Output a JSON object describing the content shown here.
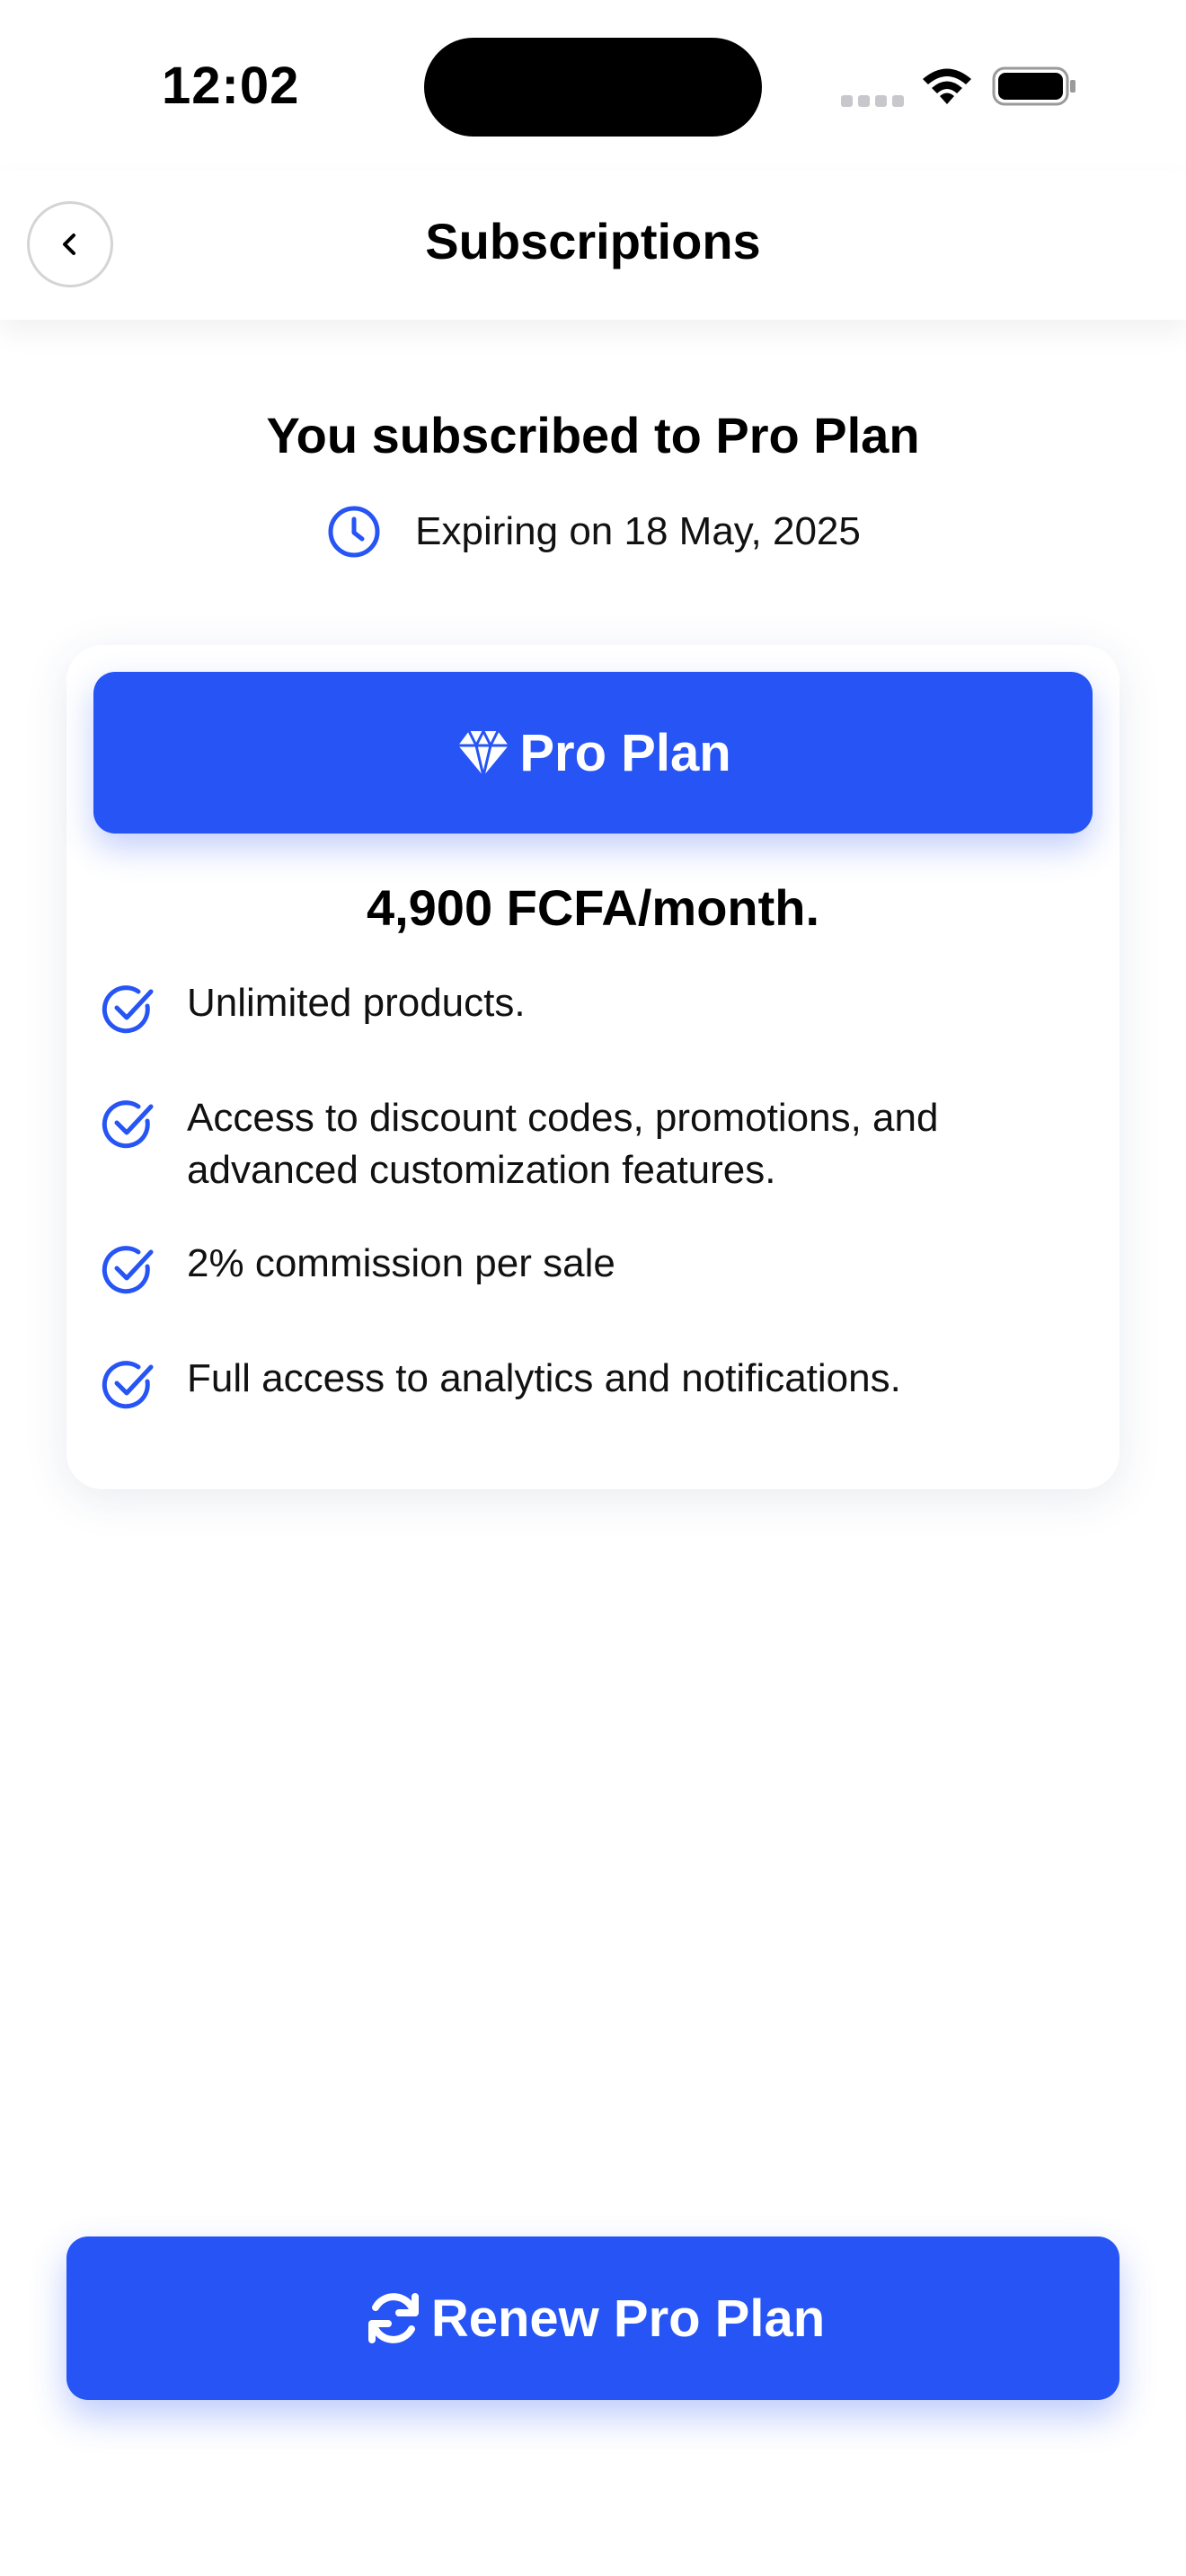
{
  "status_bar": {
    "time": "12:02",
    "icons": [
      "cellular-signal-icon",
      "wifi-icon",
      "battery-icon"
    ]
  },
  "header": {
    "title": "Subscriptions",
    "back_icon": "chevron-left-icon"
  },
  "subscription": {
    "title": "You subscribed to Pro Plan",
    "expiry_icon": "clock-icon",
    "expiry_text": "Expiring on 18 May, 2025"
  },
  "plan": {
    "icon": "diamond-icon",
    "name": "Pro Plan",
    "price": "4,900 FCFA/month.",
    "features": [
      "Unlimited products.",
      "Access to discount codes, promotions, and advanced customization features.",
      "2% commission per sale",
      "Full access to analytics and notifications."
    ],
    "feature_icon": "check-circle-icon"
  },
  "renew_button": {
    "icon": "refresh-icon",
    "label": "Renew Pro Plan"
  },
  "colors": {
    "accent": "#2654F5",
    "text": "#000000",
    "background": "#FFFFFF"
  }
}
